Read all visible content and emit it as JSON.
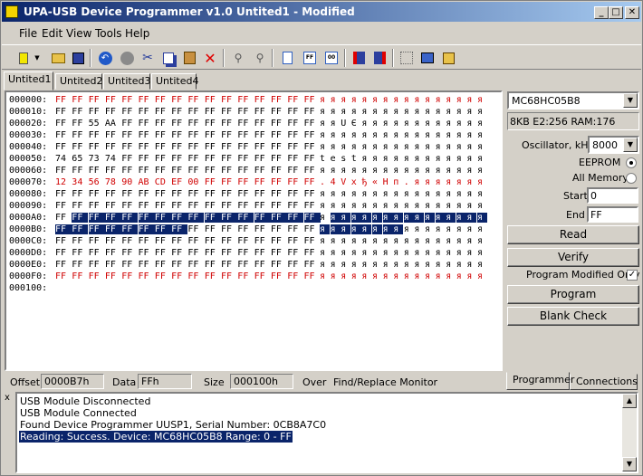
{
  "window": {
    "title": "UPA-USB Device Programmer v1.0  Untited1 - Modified",
    "min_glyph": "_",
    "max_glyph": "□",
    "close_glyph": "✕"
  },
  "menu": [
    "File",
    "Edit",
    "View",
    "Tools",
    "Help"
  ],
  "toolbar_icons": [
    "new-icon",
    "dropdown-arrow-icon",
    "open-folder-icon",
    "save-icon",
    "undo-icon",
    "stop-icon",
    "cut-icon",
    "copy-icon",
    "paste-icon",
    "delete-icon",
    "find-icon",
    "find-next-icon",
    "document-icon",
    "fill-ff-icon",
    "fill-00-icon",
    "chip-read-icon",
    "chip-write-icon",
    "grid-icon",
    "erase-icon",
    "settings-icon"
  ],
  "tabs": [
    "Untited1",
    "Untited2",
    "Untited3",
    "Untited4"
  ],
  "active_tab": 0,
  "hex": {
    "rows": [
      {
        "addr": "000000:",
        "bytes": [
          "FF",
          "FF",
          "FF",
          "FF",
          "FF",
          "FF",
          "FF",
          "FF",
          "FF",
          "FF",
          "FF",
          "FF",
          "FF",
          "FF",
          "FF",
          "FF"
        ],
        "ascii": "яяяяяяяяяяяяяяяя"
      },
      {
        "addr": "000010:",
        "bytes": [
          "FF",
          "FF",
          "FF",
          "FF",
          "FF",
          "FF",
          "FF",
          "FF",
          "FF",
          "FF",
          "FF",
          "FF",
          "FF",
          "FF",
          "FF",
          "FF"
        ],
        "ascii": "яяяяяяяяяяяяяяяя"
      },
      {
        "addr": "000020:",
        "bytes": [
          "FF",
          "FF",
          "55",
          "AA",
          "FF",
          "FF",
          "FF",
          "FF",
          "FF",
          "FF",
          "FF",
          "FF",
          "FF",
          "FF",
          "FF",
          "FF"
        ],
        "ascii": "яяUЄяяяяяяяяяяяя"
      },
      {
        "addr": "000030:",
        "bytes": [
          "FF",
          "FF",
          "FF",
          "FF",
          "FF",
          "FF",
          "FF",
          "FF",
          "FF",
          "FF",
          "FF",
          "FF",
          "FF",
          "FF",
          "FF",
          "FF"
        ],
        "ascii": "яяяяяяяяяяяяяяяя"
      },
      {
        "addr": "000040:",
        "bytes": [
          "FF",
          "FF",
          "FF",
          "FF",
          "FF",
          "FF",
          "FF",
          "FF",
          "FF",
          "FF",
          "FF",
          "FF",
          "FF",
          "FF",
          "FF",
          "FF"
        ],
        "ascii": "яяяяяяяяяяяяяяяя"
      },
      {
        "addr": "000050:",
        "bytes": [
          "74",
          "65",
          "73",
          "74",
          "FF",
          "FF",
          "FF",
          "FF",
          "FF",
          "FF",
          "FF",
          "FF",
          "FF",
          "FF",
          "FF",
          "FF"
        ],
        "ascii": "testяяяяяяяяяяяя"
      },
      {
        "addr": "000060:",
        "bytes": [
          "FF",
          "FF",
          "FF",
          "FF",
          "FF",
          "FF",
          "FF",
          "FF",
          "FF",
          "FF",
          "FF",
          "FF",
          "FF",
          "FF",
          "FF",
          "FF"
        ],
        "ascii": "яяяяяяяяяяяяяяяя"
      },
      {
        "addr": "000070:",
        "bytes": [
          "12",
          "34",
          "56",
          "78",
          "90",
          "AB",
          "CD",
          "EF",
          "00",
          "FF",
          "FF",
          "FF",
          "FF",
          "FF",
          "FF",
          "FF"
        ],
        "ascii": ".4Vxђ«Нп.яяяяяяя"
      },
      {
        "addr": "000080:",
        "bytes": [
          "FF",
          "FF",
          "FF",
          "FF",
          "FF",
          "FF",
          "FF",
          "FF",
          "FF",
          "FF",
          "FF",
          "FF",
          "FF",
          "FF",
          "FF",
          "FF"
        ],
        "ascii": "яяяяяяяяяяяяяяяя"
      },
      {
        "addr": "000090:",
        "bytes": [
          "FF",
          "FF",
          "FF",
          "FF",
          "FF",
          "FF",
          "FF",
          "FF",
          "FF",
          "FF",
          "FF",
          "FF",
          "FF",
          "FF",
          "FF",
          "FF"
        ],
        "ascii": "яяяяяяяяяяяяяяяя"
      },
      {
        "addr": "0000A0:",
        "bytes": [
          "FF",
          "FF",
          "FF",
          "FF",
          "FF",
          "FF",
          "FF",
          "FF",
          "FF",
          "FF",
          "FF",
          "FF",
          "FF",
          "FF",
          "FF",
          "FF"
        ],
        "ascii": "яяяяяяяяяяяяяяяя"
      },
      {
        "addr": "0000B0:",
        "bytes": [
          "FF",
          "FF",
          "FF",
          "FF",
          "FF",
          "FF",
          "FF",
          "FF",
          "FF",
          "FF",
          "FF",
          "FF",
          "FF",
          "FF",
          "FF",
          "FF"
        ],
        "ascii": "яяяяяяяяяяяяяяяя"
      },
      {
        "addr": "0000C0:",
        "bytes": [
          "FF",
          "FF",
          "FF",
          "FF",
          "FF",
          "FF",
          "FF",
          "FF",
          "FF",
          "FF",
          "FF",
          "FF",
          "FF",
          "FF",
          "FF",
          "FF"
        ],
        "ascii": "яяяяяяяяяяяяяяяя"
      },
      {
        "addr": "0000D0:",
        "bytes": [
          "FF",
          "FF",
          "FF",
          "FF",
          "FF",
          "FF",
          "FF",
          "FF",
          "FF",
          "FF",
          "FF",
          "FF",
          "FF",
          "FF",
          "FF",
          "FF"
        ],
        "ascii": "яяяяяяяяяяяяяяяя"
      },
      {
        "addr": "0000E0:",
        "bytes": [
          "FF",
          "FF",
          "FF",
          "FF",
          "FF",
          "FF",
          "FF",
          "FF",
          "FF",
          "FF",
          "FF",
          "FF",
          "FF",
          "FF",
          "FF",
          "FF"
        ],
        "ascii": "яяяяяяяяяяяяяяяя"
      },
      {
        "addr": "0000F0:",
        "bytes": [
          "FF",
          "FF",
          "FF",
          "FF",
          "FF",
          "FF",
          "FF",
          "FF",
          "FF",
          "FF",
          "FF",
          "FF",
          "FF",
          "FF",
          "FF",
          "FF"
        ],
        "ascii": "яяяяяяяяяяяяяяяя"
      },
      {
        "addr": "000100:",
        "bytes": [],
        "ascii": ""
      }
    ],
    "red_rows": [
      0,
      7,
      15
    ],
    "modified_color": "#d00000",
    "selection": {
      "start": 161,
      "end": 183,
      "color": "#0a246a"
    }
  },
  "device": {
    "name": "MC68HC05B8",
    "info": "8KB E2:256 RAM:176",
    "osc_label": "Oscillator, kHz",
    "osc_value": "8000",
    "eeprom_label": "EEPROM",
    "allmem_label": "All Memory",
    "eeprom_selected": true,
    "start_label": "Start",
    "start_value": "0",
    "end_label": "End",
    "end_value": "FF",
    "read_label": "Read",
    "verify_label": "Verify",
    "pmo_label": "Program Modified Only",
    "pmo_checked": true,
    "check_glyph": "✓",
    "program_label": "Program",
    "blank_label": "Blank Check"
  },
  "status": {
    "offset_label": "Offset",
    "offset_value": "0000B7h",
    "data_label": "Data",
    "data_value": "FFh",
    "size_label": "Size",
    "size_value": "000100h",
    "over_label": "Over",
    "monitor_label": "Find/Replace Monitor"
  },
  "bottom_tabs": [
    "Programmer",
    "Connections"
  ],
  "log": {
    "close_glyph": "x",
    "lines": [
      "USB Module Disconnected",
      "USB Module Connected",
      "Found Device Programmer UUSP1, Serial Number: 0CB8A7C0",
      "Reading: Success. Device: MC68HC05B8 Range: 0 - FF"
    ],
    "selected_line": 3
  }
}
